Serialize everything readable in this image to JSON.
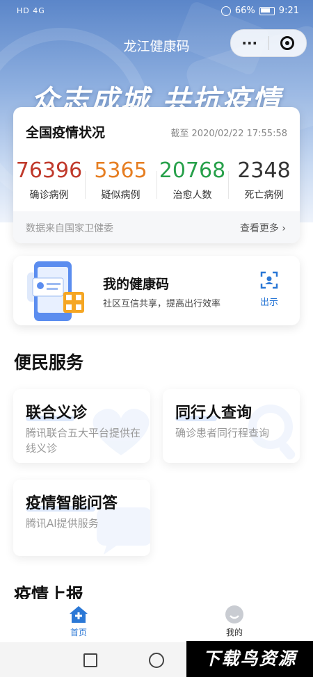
{
  "status_bar": {
    "left": "HD 4G",
    "battery": "66%",
    "time": "9:21"
  },
  "header": {
    "title": "龙江健康码",
    "more_icon": "···"
  },
  "banner": {
    "slogan": "众志成城 共抗疫情"
  },
  "stats": {
    "title": "全国疫情状况",
    "as_of": "截至 2020/02/22 17:55:58",
    "items": [
      {
        "value": "76396",
        "label": "确诊病例",
        "color": "#c0392b"
      },
      {
        "value": "5365",
        "label": "疑似病例",
        "color": "#e67e22"
      },
      {
        "value": "20768",
        "label": "治愈人数",
        "color": "#27a04a"
      },
      {
        "value": "2348",
        "label": "死亡病例",
        "color": "#333333"
      }
    ],
    "source": "数据来自国家卫健委",
    "more": "查看更多 ›"
  },
  "health_code": {
    "title": "我的健康码",
    "subtitle": "社区互信共享，提高出行效率",
    "show_label": "出示"
  },
  "services": {
    "title": "便民服务",
    "items": [
      {
        "title": "联合义诊",
        "subtitle": "腾讯联合五大平台提供在线义诊"
      },
      {
        "title": "同行人查询",
        "subtitle": "确诊患者同行程查询"
      },
      {
        "title": "疫情智能问答",
        "subtitle": "腾讯AI提供服务"
      }
    ]
  },
  "report": {
    "title": "疫情上报"
  },
  "tabbar": {
    "home": "首页",
    "mine": "我的"
  },
  "watermark": "下载鸟资源"
}
